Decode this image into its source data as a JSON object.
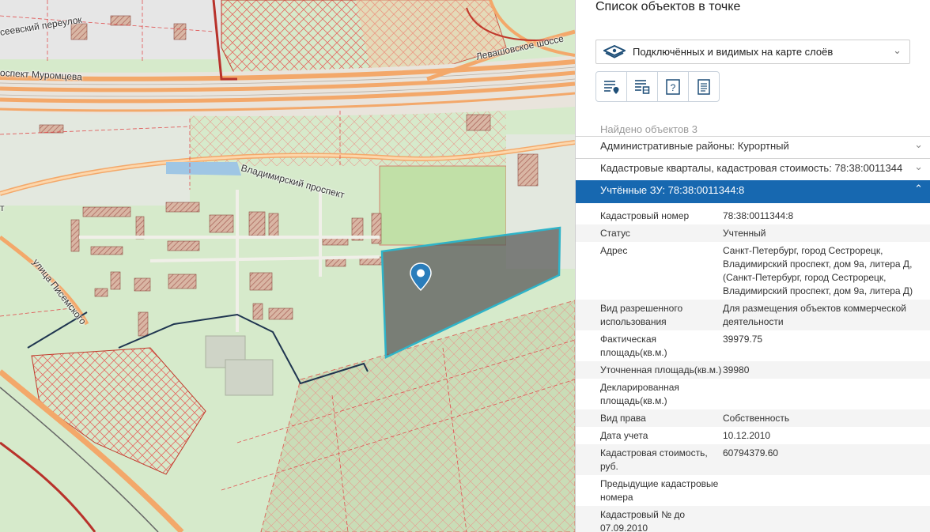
{
  "map": {
    "labels": {
      "pereulok": "сеевский переулок",
      "muromtseva": "оспект Муромцева",
      "levashovskoe": "Левашовское шоссе",
      "vladimirsky": "Владимирский проспект",
      "pisemskogo": "улица Писемского",
      "edge_t": "т"
    },
    "colors": {
      "base": "#d2e7c4",
      "selected_fill": "#555555",
      "selected_stroke": "#2fb3c8",
      "road": "#f5b77c",
      "parcel": "#e0555a",
      "marker": "#2a7dbb"
    }
  },
  "panel": {
    "title": "Список объектов в точке",
    "layer_select": {
      "icon": "layers-icon",
      "value": "Подключённых и видимых на карте слоёв"
    },
    "tools": [
      {
        "name": "list-location-icon"
      },
      {
        "name": "list-grid-icon"
      },
      {
        "name": "help-icon"
      },
      {
        "name": "document-icon"
      }
    ],
    "found_text": "Найдено объектов 3",
    "accordion": [
      {
        "label": "Административные районы: Курортный"
      },
      {
        "label": "Кадастровые кварталы, кадастровая стоимость: 78:38:0011344"
      },
      {
        "label": "Учтённые ЗУ: 78:38:0011344:8"
      }
    ],
    "properties": [
      {
        "key": "Кадастровый номер",
        "value": "78:38:0011344:8"
      },
      {
        "key": "Статус",
        "value": "Учтенный"
      },
      {
        "key": "Адрес",
        "value": "Санкт-Петербург, город Сестрорецк, Владимирский проспект, дом 9а, литера Д, (Санкт-Петербург, город Сестрорецк, Владимирский проспект, дом 9а, литера Д)"
      },
      {
        "key": "Вид разрешенного использования",
        "value": "Для размещения объектов коммерческой деятельности"
      },
      {
        "key": "Фактическая площадь(кв.м.)",
        "value": "39979.75"
      },
      {
        "key": "Уточненная площадь(кв.м.)",
        "value": "39980"
      },
      {
        "key": "Декларированная площадь(кв.м.)",
        "value": ""
      },
      {
        "key": "Вид права",
        "value": "Собственность"
      },
      {
        "key": "Дата учета",
        "value": "10.12.2010"
      },
      {
        "key": "Кадастровая стоимость, руб.",
        "value": "60794379.60"
      },
      {
        "key": "Предыдущие кадастровые номера",
        "value": ""
      },
      {
        "key": "Кадастровый № до 07.09.2010",
        "value": ""
      }
    ]
  }
}
